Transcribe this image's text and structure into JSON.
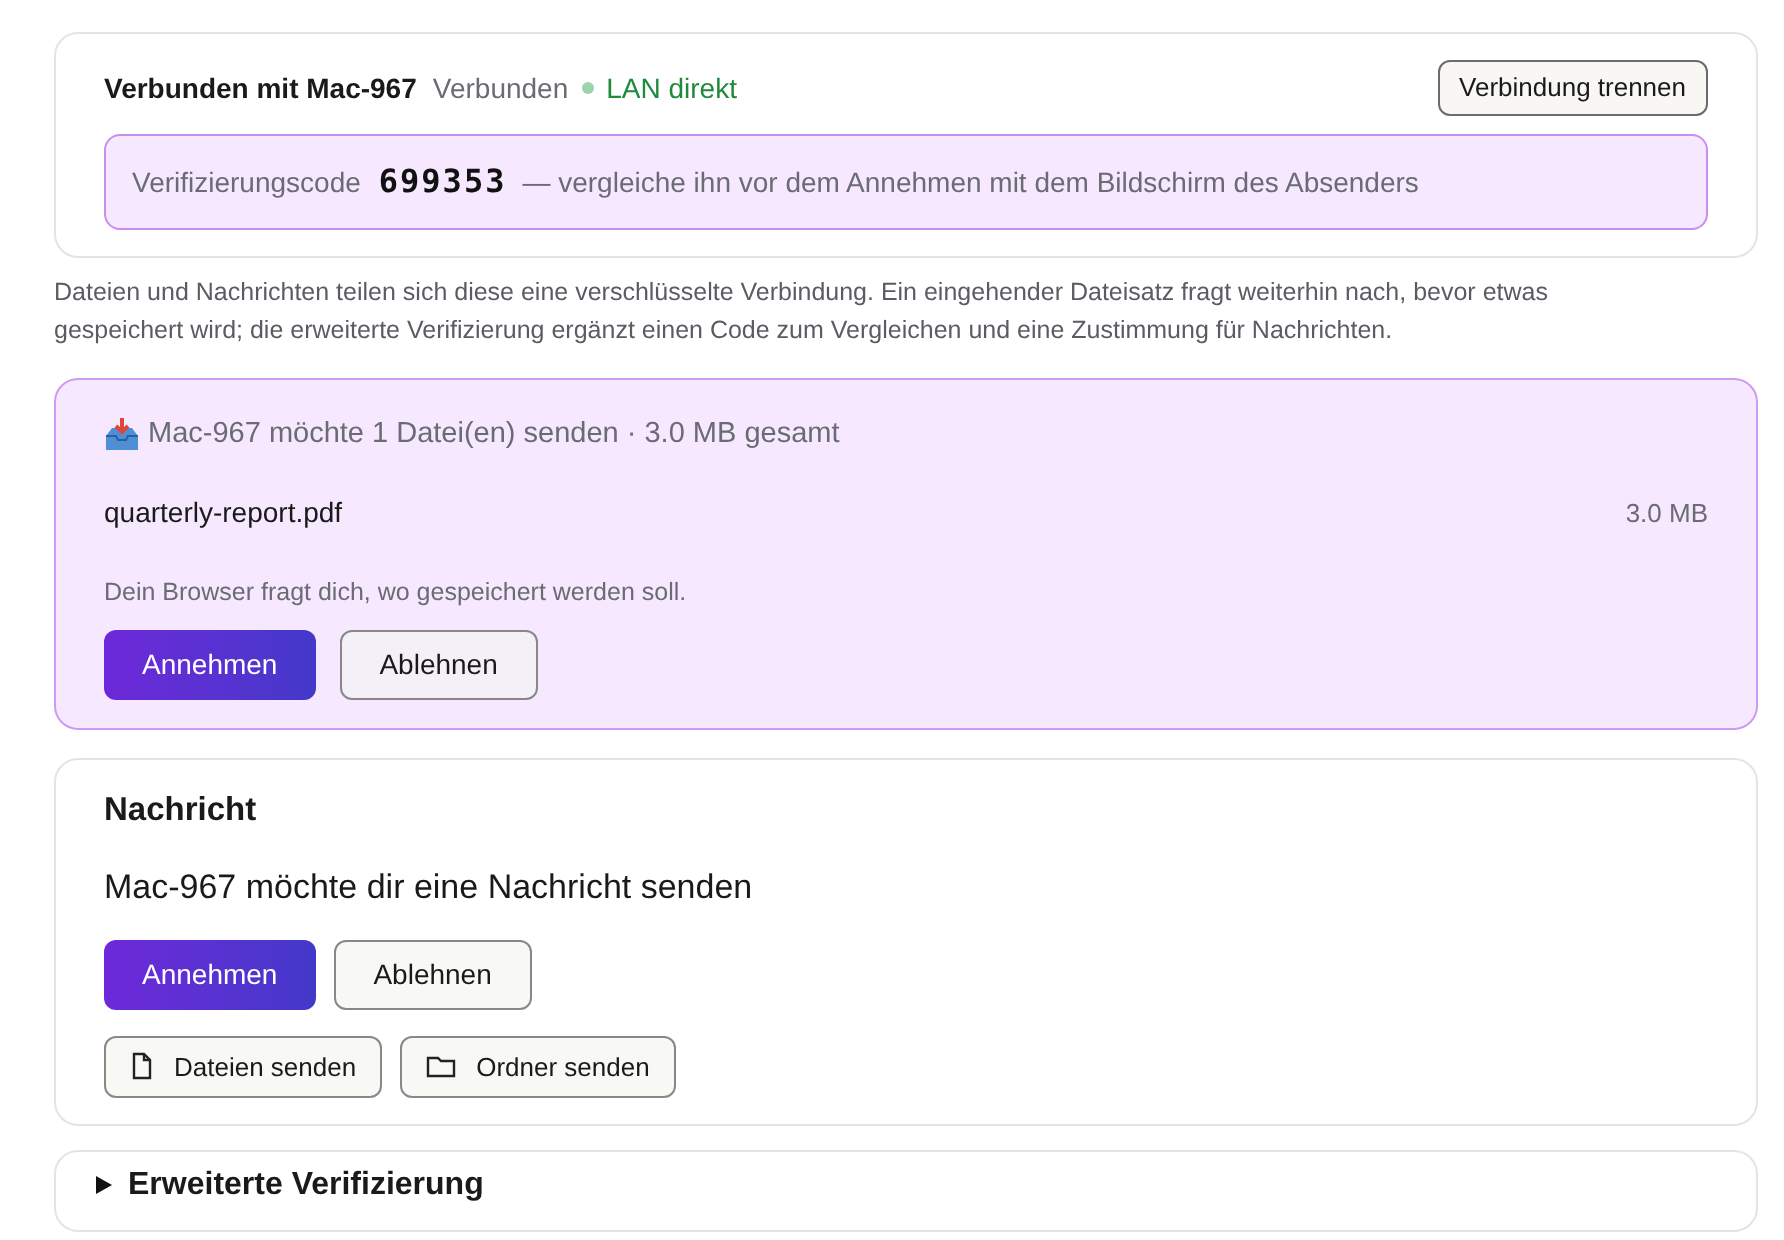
{
  "connection": {
    "title": "Verbunden mit Mac-967",
    "status": "Verbunden",
    "route": "LAN direkt",
    "disconnect_button": "Verbindung trennen",
    "verification": {
      "label": "Verifizierungscode",
      "code": "699353",
      "hint": "— vergleiche ihn vor dem Annehmen mit dem Bildschirm des Absenders"
    }
  },
  "info_text": "Dateien und Nachrichten teilen sich diese eine verschlüsselte Verbindung. Ein eingehender Dateisatz fragt weiterhin nach, bevor etwas gespeichert wird; die erweiterte Verifizierung ergänzt einen Code zum Vergleichen und eine Zustimmung für Nachrichten.",
  "file_offer": {
    "title": "Mac-967 möchte 1 Datei(en) senden · 3.0 MB gesamt",
    "files": [
      {
        "name": "quarterly-report.pdf",
        "size": "3.0 MB"
      }
    ],
    "note": "Dein Browser fragt dich, wo gespeichert werden soll.",
    "accept_button": "Annehmen",
    "reject_button": "Ablehnen"
  },
  "message": {
    "heading": "Nachricht",
    "text": "Mac-967 möchte dir eine Nachricht senden",
    "accept_button": "Annehmen",
    "reject_button": "Ablehnen",
    "actions": [
      {
        "kind": "file",
        "label": "Dateien senden"
      },
      {
        "kind": "folder",
        "label": "Ordner senden"
      }
    ]
  },
  "advanced": {
    "title": "Erweiterte Verifizierung",
    "expanded": false
  }
}
